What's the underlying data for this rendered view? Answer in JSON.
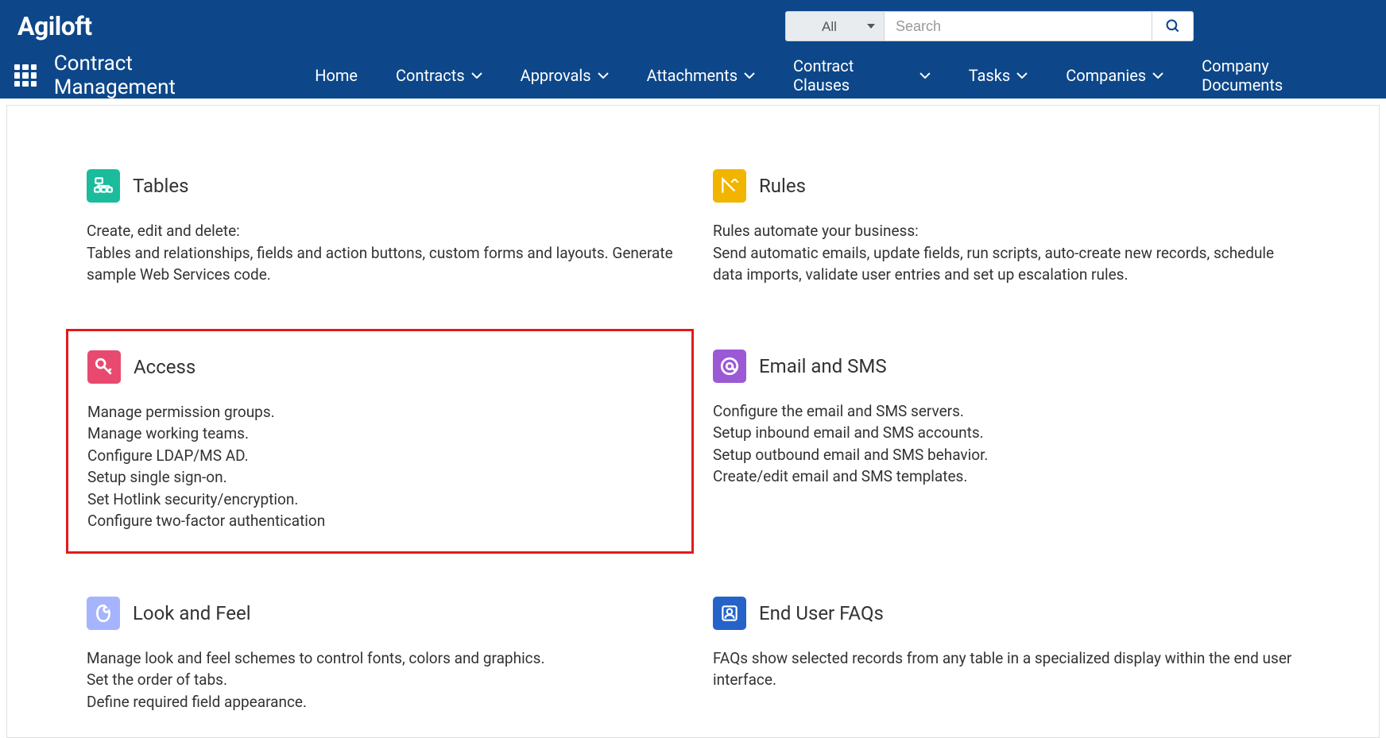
{
  "logo": "Agiloft",
  "search": {
    "filter": "All",
    "placeholder": "Search"
  },
  "app_title": "Contract Management",
  "nav": [
    {
      "label": "Home",
      "has_dropdown": false
    },
    {
      "label": "Contracts",
      "has_dropdown": true
    },
    {
      "label": "Approvals",
      "has_dropdown": true
    },
    {
      "label": "Attachments",
      "has_dropdown": true
    },
    {
      "label": "Contract Clauses",
      "has_dropdown": true
    },
    {
      "label": "Tasks",
      "has_dropdown": true
    },
    {
      "label": "Companies",
      "has_dropdown": true
    },
    {
      "label": "Company Documents",
      "has_dropdown": false
    }
  ],
  "sections": {
    "tables": {
      "title": "Tables",
      "desc": "Create, edit and delete:\nTables and relationships, fields and action buttons, custom forms and layouts. Generate sample Web Services code."
    },
    "rules": {
      "title": "Rules",
      "desc": "Rules automate your business:\nSend automatic emails, update fields, run scripts, auto-create new records, schedule data imports, validate user entries and set up escalation rules."
    },
    "access": {
      "title": "Access",
      "desc": "Manage permission groups.\nManage working teams.\nConfigure LDAP/MS AD.\nSetup single sign-on.\nSet Hotlink security/encryption.\nConfigure two-factor authentication"
    },
    "email": {
      "title": "Email and SMS",
      "desc": "Configure the email and SMS servers.\nSetup inbound email and SMS accounts.\nSetup outbound email and SMS behavior.\nCreate/edit email and SMS templates."
    },
    "look": {
      "title": "Look and Feel",
      "desc": "Manage look and feel schemes to control fonts, colors and graphics.\nSet the order of tabs.\nDefine required field appearance."
    },
    "faqs": {
      "title": "End User FAQs",
      "desc": "FAQs show selected records from any table in a specialized display within the end user interface."
    }
  },
  "colors": {
    "header_bg": "#0d4789",
    "highlight_border": "#e11b1b"
  }
}
